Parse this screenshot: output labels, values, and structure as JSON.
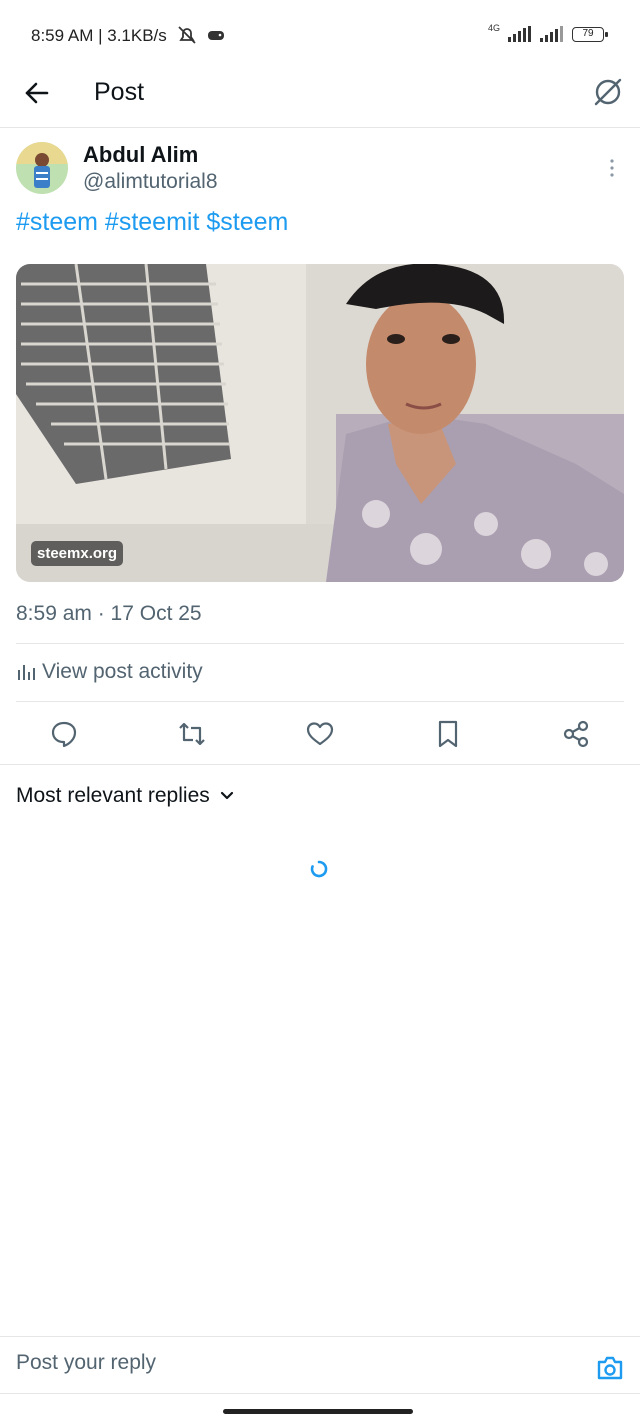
{
  "status_bar": {
    "time_speed": "8:59 AM | 3.1KB/s",
    "network": "4G",
    "battery": "79"
  },
  "header": {
    "title": "Post"
  },
  "post": {
    "author_name": "Abdul Alim",
    "author_handle": "@alimtutorial8",
    "text": "#steem #steemit $steem",
    "media_watermark": "steemx.org",
    "timestamp": "8:59 am · 17 Oct 25",
    "view_activity": "View post activity"
  },
  "replies": {
    "filter_label": "Most relevant replies"
  },
  "reply_bar": {
    "placeholder": "Post your reply"
  },
  "colors": {
    "accent": "#1d9bf0",
    "secondary_text": "#536471",
    "divider": "#e6e6e6"
  },
  "icons": {
    "back": "arrow-left-icon",
    "grok": "grok-icon",
    "more": "more-vertical-icon",
    "stats": "bar-chart-icon",
    "reply": "comment-icon",
    "repost": "repost-icon",
    "like": "heart-icon",
    "bookmark": "bookmark-icon",
    "share": "share-icon",
    "filter": "chevron-down-icon",
    "camera": "camera-icon"
  }
}
